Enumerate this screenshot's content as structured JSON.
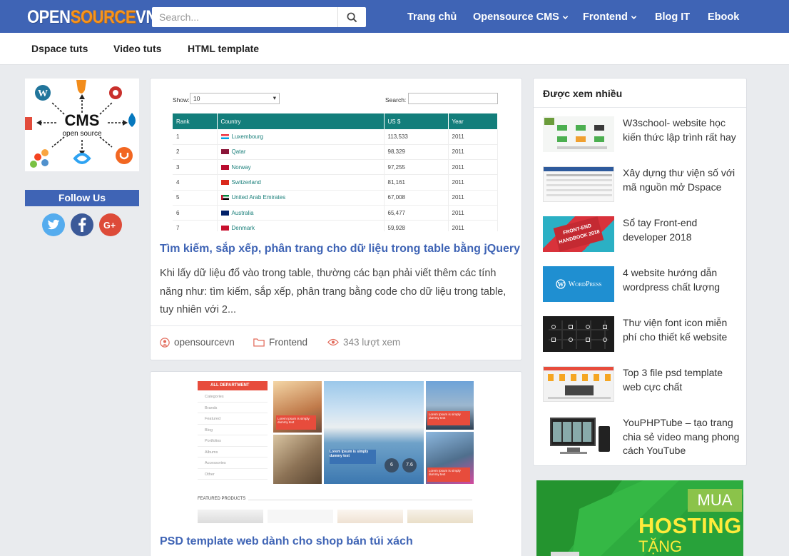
{
  "header": {
    "logo_part1": "OPEN",
    "logo_part2": "SOURCE",
    "logo_part3": "VN",
    "search_placeholder": "Search...",
    "nav": [
      {
        "label": "Trang chủ"
      },
      {
        "label": "Opensource CMS"
      },
      {
        "label": "Frontend"
      },
      {
        "label": "Blog IT"
      },
      {
        "label": "Ebook"
      }
    ]
  },
  "subnav": [
    {
      "label": "Dspace tuts"
    },
    {
      "label": "Video tuts"
    },
    {
      "label": "HTML template"
    }
  ],
  "left": {
    "cms_title": "CMS",
    "cms_sub": "open source",
    "follow_label": "Follow Us",
    "social": [
      {
        "icon": "twitter-icon",
        "color": "#55acee"
      },
      {
        "icon": "facebook-icon",
        "color": "#3b5998"
      },
      {
        "icon": "google-plus-icon",
        "color": "#dd4b39"
      }
    ]
  },
  "posts": [
    {
      "title": "Tìm kiếm, sắp xếp, phân trang cho dữ liệu trong table bằng jQuery",
      "excerpt": "Khi lấy dữ liệu đổ vào trong table, thường các bạn phải viết thêm các tính năng như: tìm kiếm, sắp xếp, phân trang bằng code cho dữ liệu trong table, tuy nhiên với 2...",
      "author": "opensourcevn",
      "category": "Frontend",
      "views": "343 lượt xem",
      "image": {
        "show_label": "Show:",
        "show_value": "10",
        "search_label": "Search:",
        "headers": [
          "Rank",
          "Country",
          "US $",
          "Year"
        ],
        "rows": [
          [
            "1",
            "Luxembourg",
            "113,533",
            "2011"
          ],
          [
            "2",
            "Qatar",
            "98,329",
            "2011"
          ],
          [
            "3",
            "Norway",
            "97,255",
            "2011"
          ],
          [
            "4",
            "Switzerland",
            "81,161",
            "2011"
          ],
          [
            "5",
            "United Arab Emirates",
            "67,008",
            "2011"
          ],
          [
            "6",
            "Australia",
            "65,477",
            "2011"
          ],
          [
            "7",
            "Denmark",
            "59,928",
            "2011"
          ]
        ]
      }
    },
    {
      "title": "PSD template web dành cho shop bán túi xách",
      "image": {
        "dept_label": "ALL DEPARTMENT",
        "categories": [
          "Categories",
          "Brands",
          "Featured",
          "Blog",
          "Portfolios",
          "Albums",
          "Accessories",
          "Other"
        ],
        "promo_text": "Lorem Ipsum is simply dummy text",
        "featured_label": "FEATURED PRODUCTS",
        "badges": [
          "6",
          "7.6"
        ]
      }
    }
  ],
  "sidebar": {
    "title": "Được xem nhiều",
    "items": [
      {
        "title": "W3school- website học kiến thức lập trình rất hay"
      },
      {
        "title": "Xây dựng thư viện số với mã nguồn mở Dspace"
      },
      {
        "title": "Sổ tay Front-end developer 2018",
        "thumb_text": "FRONT-END HANDBOOK 2018"
      },
      {
        "title": "4 website hướng dẫn wordpress chất lượng",
        "thumb_text": "WordPress"
      },
      {
        "title": "Thư viện font icon miễn phí cho thiết kế website"
      },
      {
        "title": "Top 3 file psd template web cực chất"
      },
      {
        "title": "YouPHPTube – tạo trang chia sẻ video mang phong cách YouTube"
      }
    ]
  },
  "ad": {
    "line1": "MUA",
    "line2": "HOSTING",
    "line3": "TẶNG"
  }
}
